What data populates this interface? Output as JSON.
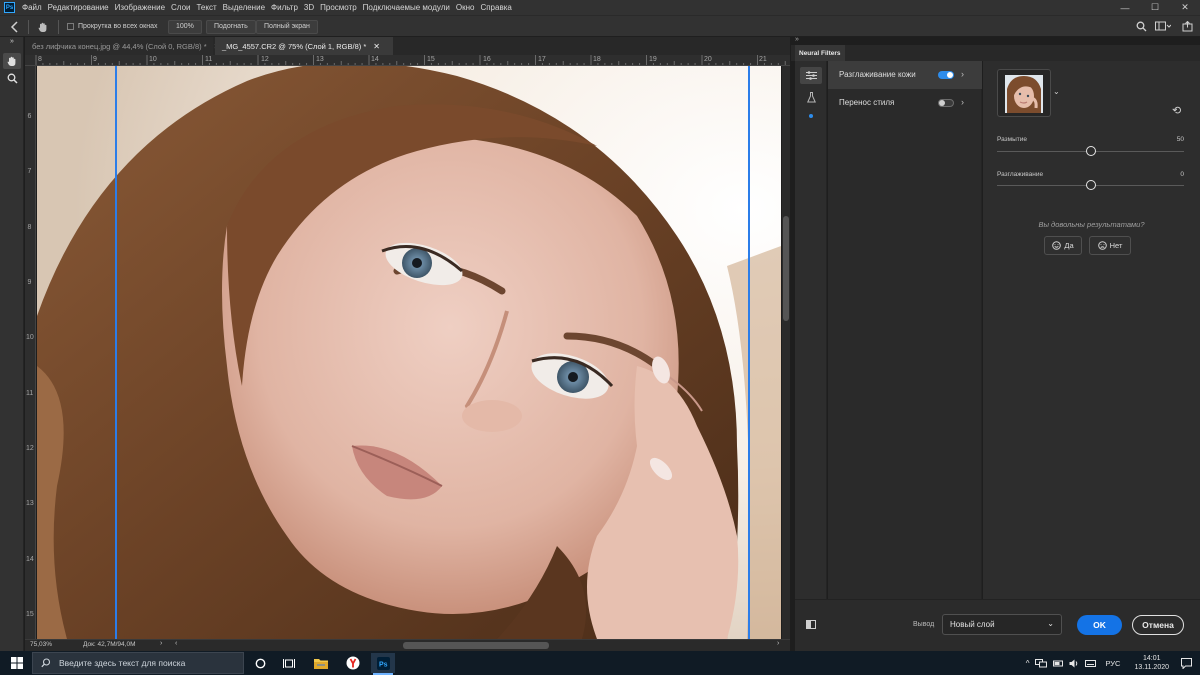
{
  "app": {
    "logo_text": "Ps"
  },
  "menu": [
    "Файл",
    "Редактирование",
    "Изображение",
    "Слои",
    "Текст",
    "Выделение",
    "Фильтр",
    "3D",
    "Просмотр",
    "Подключаемые модули",
    "Окно",
    "Справка"
  ],
  "window_controls": {
    "minimize": "—",
    "maximize": "☐",
    "close": "✕"
  },
  "options": {
    "scroll_all_label": "Прокрутка во всех окнах",
    "zoom_value": "100%",
    "fit_label": "Подогнать",
    "fullscreen_label": "Полный экран"
  },
  "tabs": [
    {
      "label": "без лифчика конец.jpg @ 44,4% (Слой 0, RGB/8) *",
      "active": false
    },
    {
      "label": "_MG_4557.CR2 @ 75% (Слой 1, RGB/8) *",
      "active": true
    }
  ],
  "ruler": {
    "top": [
      "8",
      "9",
      "10",
      "11",
      "12",
      "13",
      "14",
      "15",
      "16",
      "17",
      "18",
      "19",
      "20",
      "21"
    ],
    "left": [
      "6",
      "7",
      "8",
      "9",
      "10",
      "11",
      "12",
      "13",
      "14",
      "15"
    ]
  },
  "status": {
    "zoom": "75,03%",
    "doc": "Док: 42,7M/94,0M",
    "more": "›",
    "left": "‹",
    "right": "›"
  },
  "neural_filters": {
    "panel_title": "Neural Filters",
    "filters": [
      {
        "label": "Разглаживание кожи",
        "enabled": true
      },
      {
        "label": "Перенос стиля",
        "enabled": false
      }
    ],
    "settings": {
      "sliders": [
        {
          "label": "Размытие",
          "value": "50",
          "fraction": 0.5
        },
        {
          "label": "Разглаживание",
          "value": "0",
          "fraction": 0.5
        }
      ],
      "question": "Вы довольны результатами?",
      "yes_label": "Да",
      "no_label": "Нет"
    },
    "output_label": "Вывод",
    "output_value": "Новый слой",
    "ok_label": "OK",
    "cancel_label": "Отмена"
  },
  "taskbar": {
    "search_placeholder": "Введите здесь текст для поиска",
    "lang": "РУС",
    "time": "14:01",
    "date": "13.11.2020"
  },
  "colors": {
    "accent": "#1473e6",
    "toggle_on": "#2d8ceb",
    "guide": "#2b7de9",
    "taskbar": "#101b25"
  }
}
